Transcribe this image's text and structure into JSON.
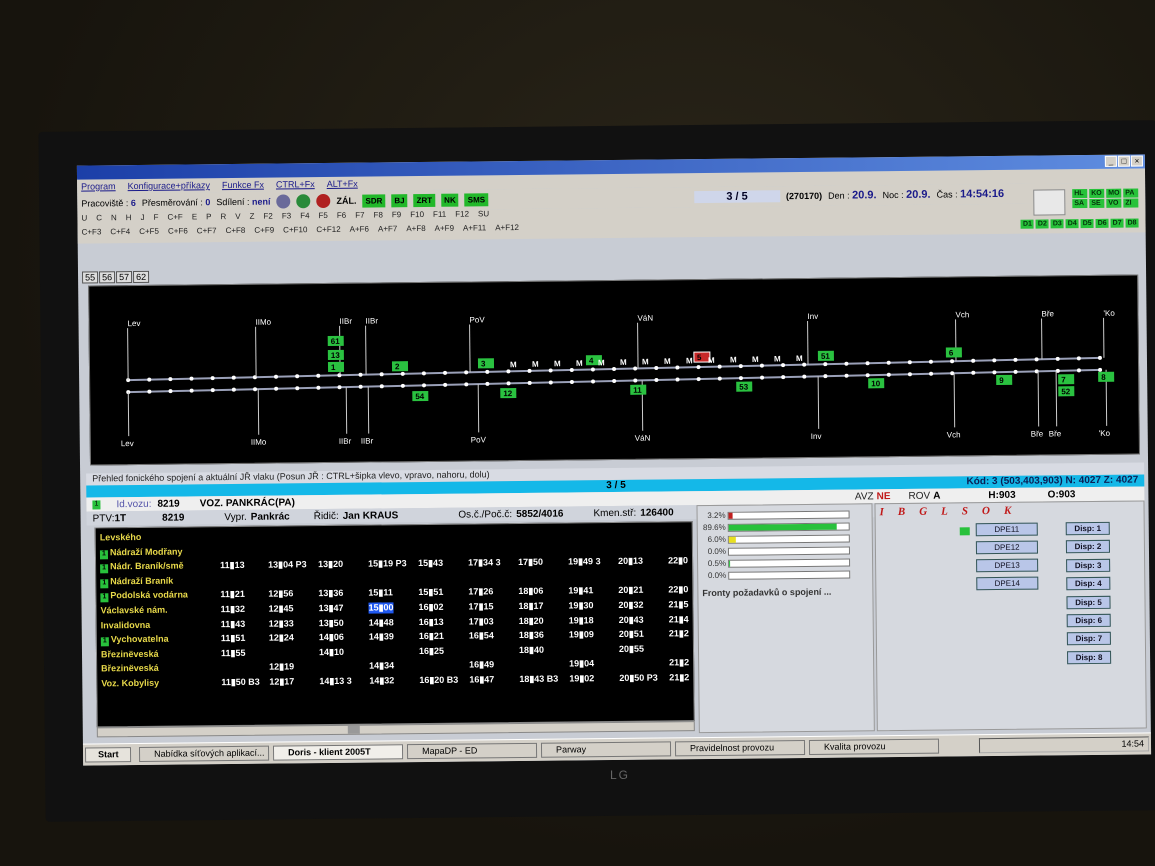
{
  "menu": [
    "Program",
    "Konfigurace+příkazy",
    "Funkce Fx",
    "CTRL+Fx",
    "ALT+Fx"
  ],
  "toolbar": {
    "pracoviste_label": "Pracoviště :",
    "pracoviste_value": "6",
    "presmerovani_label": "Přesměrování :",
    "presmerovani_value": "0",
    "sdileni_label": "Sdílení :",
    "sdileni_value": "není",
    "zal": "ZÁL.",
    "green_tags": [
      "SDR",
      "BJ",
      "ZRT",
      "NK",
      "SMS"
    ],
    "counter": "3 / 5",
    "code": "(270170)",
    "den_label": "Den :",
    "den_value": "20.9.",
    "noc_label": "Noc :",
    "noc_value": "20.9.",
    "cas_label": "Čas :",
    "cas_value": "14:54:16"
  },
  "fkeys_row1": [
    "U",
    "C",
    "N",
    "H",
    "J",
    "F",
    "C+F",
    "E",
    "P",
    "R",
    "V",
    "Z",
    "F2",
    "F3",
    "F4",
    "F5",
    "F6",
    "F7",
    "F8",
    "F9",
    "F10",
    "F11",
    "F12",
    "SU"
  ],
  "fkeys_row2": [
    "C+F3",
    "C+F4",
    "C+F5",
    "C+F6",
    "C+F7",
    "C+F8",
    "C+F9",
    "C+F10",
    "C+F12",
    "A+F6",
    "A+F7",
    "A+F8",
    "A+F9",
    "A+F11",
    "A+F12"
  ],
  "right_grid": [
    "HL",
    "KO",
    "MO",
    "PA",
    "SA",
    "SE",
    "VO",
    "ZI"
  ],
  "d_boxes": [
    "D1",
    "D2",
    "D3",
    "D4",
    "D5",
    "D6",
    "D7",
    "D8"
  ],
  "tabs": [
    "55",
    "56",
    "57",
    "62"
  ],
  "diagram": {
    "top_stops": [
      "Lev",
      "IIMo",
      "IIBr",
      "IIBr",
      "PoV",
      "VáN",
      "Inv",
      "Vch",
      "Bře",
      "'Ko"
    ],
    "bottom_stops": [
      "Lev",
      "IIMo",
      "IIBr",
      "IIBr",
      "PoV",
      "VáN",
      "Inv",
      "Vch",
      "Bře",
      "Bře",
      "'Ko"
    ],
    "top_trains": [
      "61",
      "13",
      "1",
      "2",
      "3",
      "4",
      "5",
      "51",
      "6"
    ],
    "bottom_trains": [
      "54",
      "12",
      "11",
      "53",
      "10",
      "9",
      "7",
      "52",
      "8"
    ]
  },
  "status_line": "Přehled fonického spojení a aktuální JŘ vlaku (Posun JŘ : CTRL+šipka vlevo, vpravo, nahoru, dolu)",
  "cyan_bar": {
    "page": "3 / 5",
    "kod": "Kód: 3 (503,403,903)  N: 4027  Z: 4027"
  },
  "vehicle": {
    "id_label": "Id.vozu:",
    "id_value": "8219",
    "route": "VOZ. PANKRÁC(PA)",
    "avz_label": "AVZ",
    "avz_value": "NE",
    "rov_label": "ROV",
    "rov_value": "A",
    "h_value": "H:903",
    "o_value": "O:903"
  },
  "details": {
    "ptv_label": "PTV:",
    "ptv_value": "1T",
    "ptv_id": "8219",
    "vypr_label": "Vypr.",
    "vypr_value": "Pankrác",
    "ridic_label": "Řidič:",
    "ridic_value": "Jan KRAUS",
    "os_label": "Os.č./Poč.č:",
    "os_value": "5852/4016",
    "kmen_label": "Kmen.stř:",
    "kmen_value": "126400"
  },
  "timetable": {
    "rows": [
      {
        "stop": "Levského",
        "badge": false,
        "times": []
      },
      {
        "stop": "Nádraží Modřany",
        "badge": true,
        "times": []
      },
      {
        "stop": "Nádr. Braník/smě",
        "badge": true,
        "times": [
          "11▮13",
          "13▮04 P3",
          "13▮20",
          "15▮19 P3",
          "15▮43",
          "17▮34 3",
          "17▮50",
          "19▮49 3",
          "20▮13",
          "22▮0"
        ]
      },
      {
        "stop": "Nádraží Braník",
        "badge": true,
        "times": []
      },
      {
        "stop": "Podolská vodárna",
        "badge": true,
        "times": [
          "11▮21",
          "12▮56",
          "13▮36",
          "15▮11",
          "15▮51",
          "17▮26",
          "18▮06",
          "19▮41",
          "20▮21",
          "22▮0"
        ]
      },
      {
        "stop": "Václavské nám.",
        "badge": false,
        "times": [
          "11▮32",
          "12▮45",
          "13▮47",
          "15▮00",
          "16▮02",
          "17▮15",
          "18▮17",
          "19▮30",
          "20▮32",
          "21▮5"
        ]
      },
      {
        "stop": "Invalidovna",
        "badge": false,
        "times": [
          "11▮43",
          "12▮33",
          "13▮50",
          "14▮48",
          "16▮13",
          "17▮03",
          "18▮20",
          "19▮18",
          "20▮43",
          "21▮4"
        ]
      },
      {
        "stop": "Vychovatelna",
        "badge": true,
        "times": [
          "11▮51",
          "12▮24",
          "14▮06",
          "14▮39",
          "16▮21",
          "16▮54",
          "18▮36",
          "19▮09",
          "20▮51",
          "21▮2"
        ]
      },
      {
        "stop": "Březinëveská",
        "badge": false,
        "times": [
          "11▮55",
          "",
          "14▮10",
          "",
          "16▮25",
          "",
          "18▮40",
          "",
          "20▮55",
          ""
        ]
      },
      {
        "stop": "Březinëveská",
        "badge": false,
        "times": [
          "",
          "12▮19",
          "",
          "14▮34",
          "",
          "16▮49",
          "",
          "19▮04",
          "",
          "21▮2"
        ]
      },
      {
        "stop": "Voz. Kobylisy",
        "badge": false,
        "times": [
          "11▮50 B3",
          "12▮17",
          "14▮13 3",
          "14▮32",
          "16▮20 B3",
          "16▮47",
          "18▮43 B3",
          "19▮02",
          "20▮50 P3",
          "21▮2"
        ]
      }
    ],
    "selected": "15▮00"
  },
  "queue": {
    "rows": [
      {
        "pct": "3.2%",
        "level": 0.032,
        "color": "#c02020"
      },
      {
        "pct": "89.6%",
        "level": 0.896,
        "color": "#28c13c"
      },
      {
        "pct": "6.0%",
        "level": 0.06,
        "color": "#e8e020"
      },
      {
        "pct": "0.0%",
        "level": 0,
        "color": "#28c13c"
      },
      {
        "pct": "0.5%",
        "level": 0.005,
        "color": "#28c13c"
      },
      {
        "pct": "0.0%",
        "level": 0,
        "color": "#28c13c"
      }
    ],
    "title": "Fronty požadavků o spojení ..."
  },
  "right_panel": {
    "header": [
      "I",
      "B",
      "G",
      "L",
      "S",
      "O",
      "K"
    ],
    "dpe": [
      "DPE11",
      "DPE12",
      "DPE13",
      "DPE14"
    ],
    "disp": [
      "Disp: 1",
      "Disp: 2",
      "Disp: 3",
      "Disp: 4",
      "Disp: 5",
      "Disp: 6",
      "Disp: 7",
      "Disp: 8"
    ]
  },
  "taskbar": {
    "start": "Start",
    "tasks": [
      "Nabídka síťových aplikací...",
      "Doris - klient 2005T",
      "MapaDP - ED",
      "Parway",
      "Pravidelnost provozu",
      "Kvalita provozu"
    ],
    "clock": "14:54"
  },
  "monitor_brand": "LG"
}
